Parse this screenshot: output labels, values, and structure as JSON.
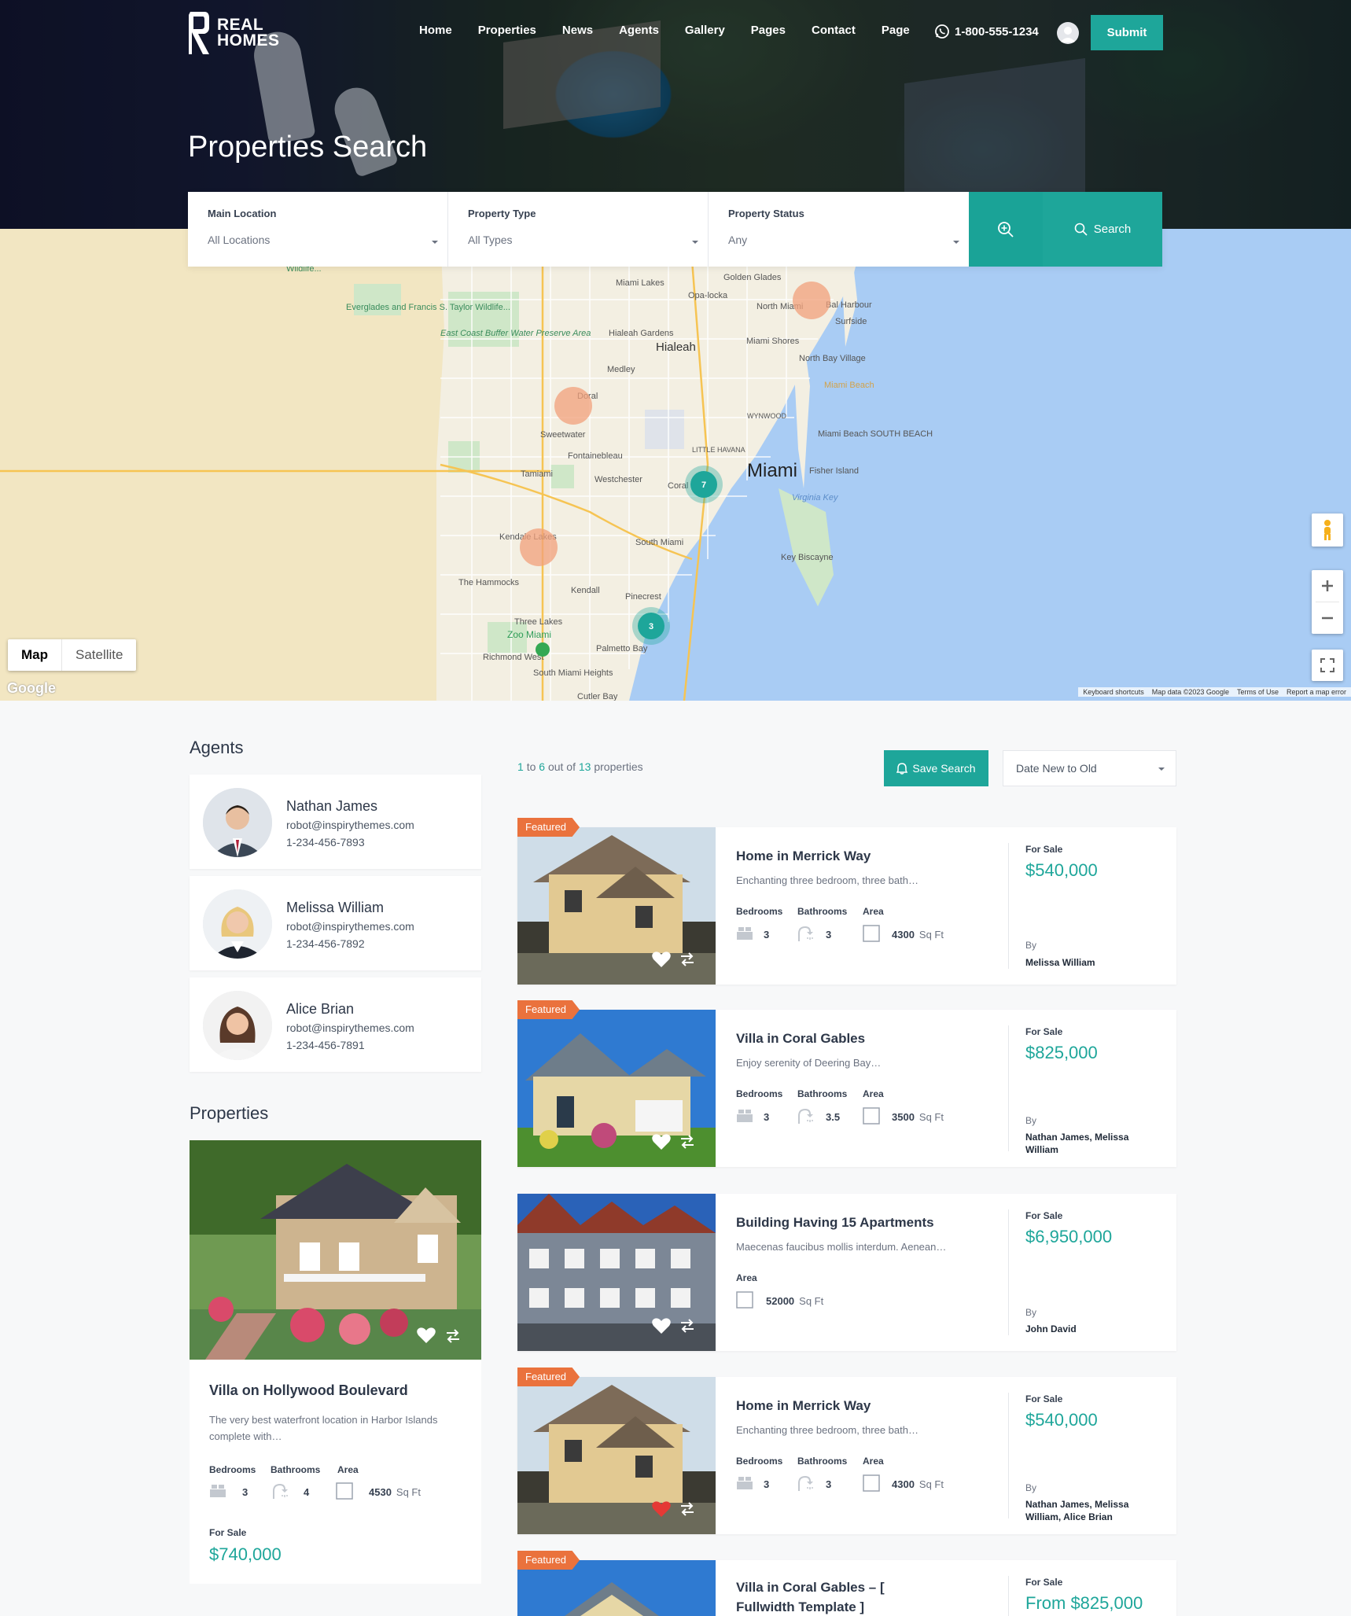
{
  "brand": {
    "line1": "REAL",
    "line2": "HOMES"
  },
  "nav": {
    "items": [
      "Home",
      "Properties",
      "News",
      "Agents",
      "Gallery",
      "Pages",
      "Contact",
      "Page"
    ],
    "phone": "1-800-555-1234",
    "submit": "Submit"
  },
  "page_title": "Properties Search",
  "search": {
    "fields": [
      {
        "label": "Main Location",
        "value": "All Locations"
      },
      {
        "label": "Property Type",
        "value": "All Types"
      },
      {
        "label": "Property Status",
        "value": "Any"
      }
    ],
    "button": "Search"
  },
  "map": {
    "type_map": "Map",
    "type_satellite": "Satellite",
    "google": "Google",
    "footer": [
      "Keyboard shortcuts",
      "Map data ©2023 Google",
      "Terms of Use",
      "Report a map error"
    ],
    "clusters": [
      "7",
      "3"
    ],
    "labels": [
      "Golden Glades",
      "Miami Lakes",
      "Opa-locka",
      "North Miami",
      "Bal Harbour",
      "Surfside",
      "Everglades and Francis S. Taylor Wildlife...",
      "East Coast Buffer Water Preserve Area",
      "Hialeah Gardens",
      "Hialeah",
      "Miami Shores",
      "North Bay Village",
      "Medley",
      "Miami Beach",
      "Doral",
      "WYNWOOD",
      "Sweetwater",
      "Fontainebleau",
      "LITTLE HAVANA",
      "Miami Beach SOUTH BEACH",
      "Tamiami",
      "Westchester",
      "Coral",
      "Miami",
      "Fisher Island",
      "Virginia Key",
      "Kendale Lakes",
      "South Miami",
      "Key Biscayne",
      "The Hammocks",
      "Kendall",
      "Pinecrest",
      "Three Lakes",
      "Zoo Miami",
      "Palmetto Bay",
      "Richmond West",
      "South Miami Heights",
      "Cutler Bay",
      "Wildlife..."
    ]
  },
  "sidebar": {
    "agents_title": "Agents",
    "agents": [
      {
        "name": "Nathan James",
        "email": "robot@inspirythemes.com",
        "phone": "1-234-456-7893"
      },
      {
        "name": "Melissa William",
        "email": "robot@inspirythemes.com",
        "phone": "1-234-456-7892"
      },
      {
        "name": "Alice Brian",
        "email": "robot@inspirythemes.com",
        "phone": "1-234-456-7891"
      }
    ],
    "properties_title": "Properties",
    "property": {
      "title": "Villa on Hollywood Boulevard",
      "desc": "The very best waterfront location in Harbor Islands complete with…",
      "h_bed": "Bedrooms",
      "h_bath": "Bathrooms",
      "h_area": "Area",
      "bed": "3",
      "bath": "4",
      "area": "4530",
      "unit": "Sq Ft",
      "status": "For Sale",
      "price": "$740,000"
    }
  },
  "results": {
    "count_a": "1",
    "count_to": "to",
    "count_b": "6",
    "count_out": "out of",
    "count_total": "13",
    "count_word": "properties",
    "save_search": "Save Search",
    "sort": "Date New to Old",
    "labels": {
      "featured": "Featured",
      "bedrooms": "Bedrooms",
      "bathrooms": "Bathrooms",
      "area": "Area",
      "unit": "Sq Ft",
      "by": "By"
    },
    "listings": [
      {
        "title": "Home in Merrick Way",
        "desc": "Enchanting three bedroom, three bath…",
        "bed": "3",
        "bath": "3",
        "area": "4300",
        "status": "For Sale",
        "price": "$540,000",
        "agent": "Melissa William"
      },
      {
        "title": "Villa in Coral Gables",
        "desc": "Enjoy serenity of Deering Bay…",
        "bed": "3",
        "bath": "3.5",
        "area": "3500",
        "status": "For Sale",
        "price": "$825,000",
        "agent": "Nathan James, Melissa William"
      },
      {
        "title": "Building Having 15 Apartments",
        "desc": "Maecenas faucibus mollis interdum. Aenean…",
        "area": "52000",
        "status": "For Sale",
        "price": "$6,950,000",
        "agent": "John David"
      },
      {
        "title": "Home in Merrick Way",
        "desc": "Enchanting three bedroom, three bath…",
        "bed": "3",
        "bath": "3",
        "area": "4300",
        "status": "For Sale",
        "price": "$540,000",
        "agent": "Nathan James, Melissa William, Alice Brian"
      },
      {
        "title": "Villa in Coral Gables – [ Fullwidth Template ]",
        "status": "For Sale",
        "price": "From $825,000"
      }
    ]
  },
  "colors": {
    "accent": "#1ea69a",
    "featured": "#ea723d",
    "water": "#a9ccf4",
    "land": "#f3efe2"
  }
}
